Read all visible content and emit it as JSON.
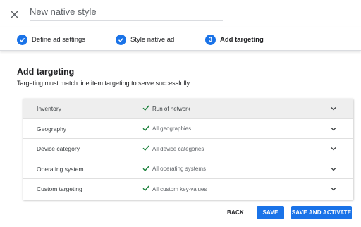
{
  "header": {
    "close_icon": "close-icon",
    "title_placeholder": "New native style"
  },
  "stepper": {
    "steps": [
      {
        "label": "Define ad settings",
        "state": "complete",
        "icon": "check-icon"
      },
      {
        "label": "Style native ad",
        "state": "complete",
        "icon": "check-icon"
      },
      {
        "label": "Add targeting",
        "state": "active",
        "number": "3"
      }
    ]
  },
  "main": {
    "heading": "Add targeting",
    "subheading": "Targeting must match line item targeting to serve successfully",
    "rows": [
      {
        "label": "Inventory",
        "value": "Run of network"
      },
      {
        "label": "Geography",
        "value": "All geographies"
      },
      {
        "label": "Device category",
        "value": "All device categories"
      },
      {
        "label": "Operating system",
        "value": "All operating systems"
      },
      {
        "label": "Custom targeting",
        "value": "All custom key-values"
      }
    ]
  },
  "footer": {
    "back_label": "BACK",
    "save_label": "SAVE",
    "save_activate_label": "SAVE AND ACTIVATE"
  },
  "colors": {
    "accent": "#1a73e8",
    "check": "#188038",
    "row_highlight": "#eeeeee"
  }
}
